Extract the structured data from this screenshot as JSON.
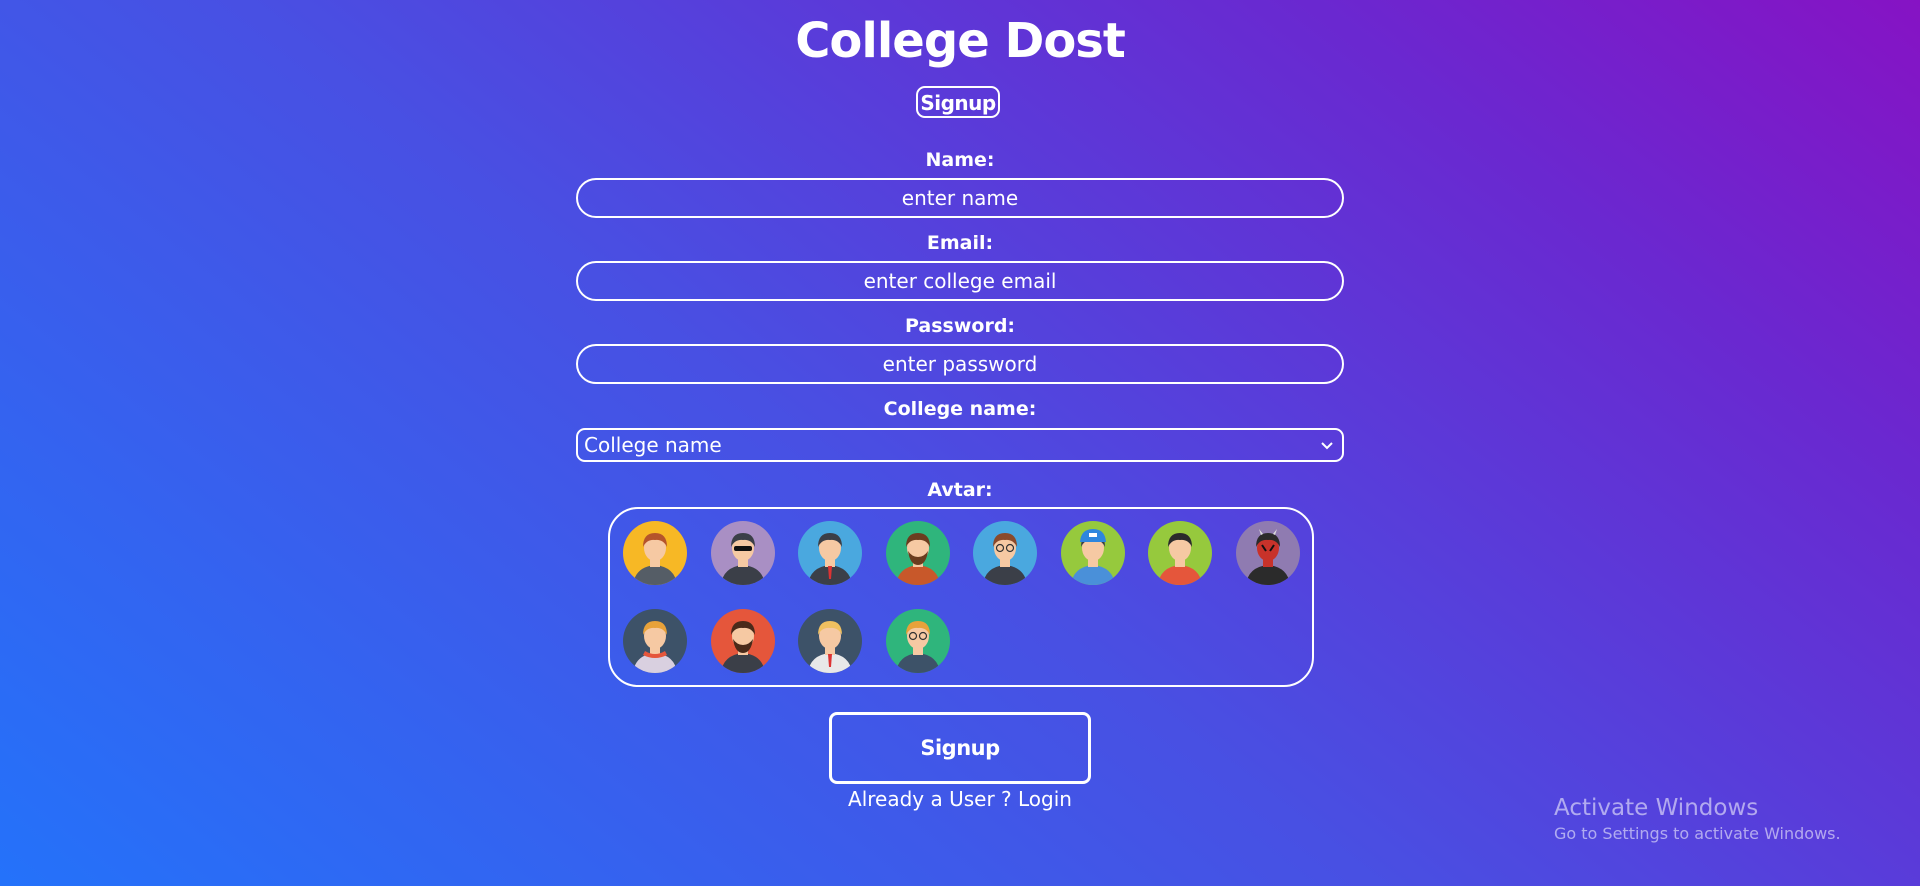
{
  "app": {
    "title": "College Dost",
    "badge": "Signup"
  },
  "form": {
    "name": {
      "label": "Name:",
      "placeholder": "enter name"
    },
    "email": {
      "label": "Email:",
      "placeholder": "enter college email"
    },
    "password": {
      "label": "Password:",
      "placeholder": "enter password"
    },
    "college": {
      "label": "College name:",
      "selected": "College name"
    },
    "avatar": {
      "label": "Avtar:",
      "options": [
        {
          "icon": "avatar-hoodie-guy",
          "bg": "#f7b825"
        },
        {
          "icon": "avatar-sunglasses-guy",
          "bg": "#a98fc4"
        },
        {
          "icon": "avatar-suit-guy",
          "bg": "#4aa8df"
        },
        {
          "icon": "avatar-bearded-guy",
          "bg": "#2fb57c"
        },
        {
          "icon": "avatar-glasses-woman",
          "bg": "#4aa8df"
        },
        {
          "icon": "avatar-cap-girl",
          "bg": "#96c93d"
        },
        {
          "icon": "avatar-dark-hair-woman",
          "bg": "#96c93d"
        },
        {
          "icon": "avatar-darth-maul",
          "bg": "#8f7bb1"
        },
        {
          "icon": "avatar-blonde-scarf-woman",
          "bg": "#3d5268"
        },
        {
          "icon": "avatar-red-bearded-guy",
          "bg": "#e5563b"
        },
        {
          "icon": "avatar-blonde-tie-guy",
          "bg": "#3d5268"
        },
        {
          "icon": "avatar-glasses-blonde-guy",
          "bg": "#2fb57c"
        }
      ]
    },
    "submit_label": "Signup",
    "login_prompt": "Already a User ? Login"
  },
  "os_watermark": {
    "line1": "Activate Windows",
    "line2": "Go to Settings to activate Windows."
  }
}
